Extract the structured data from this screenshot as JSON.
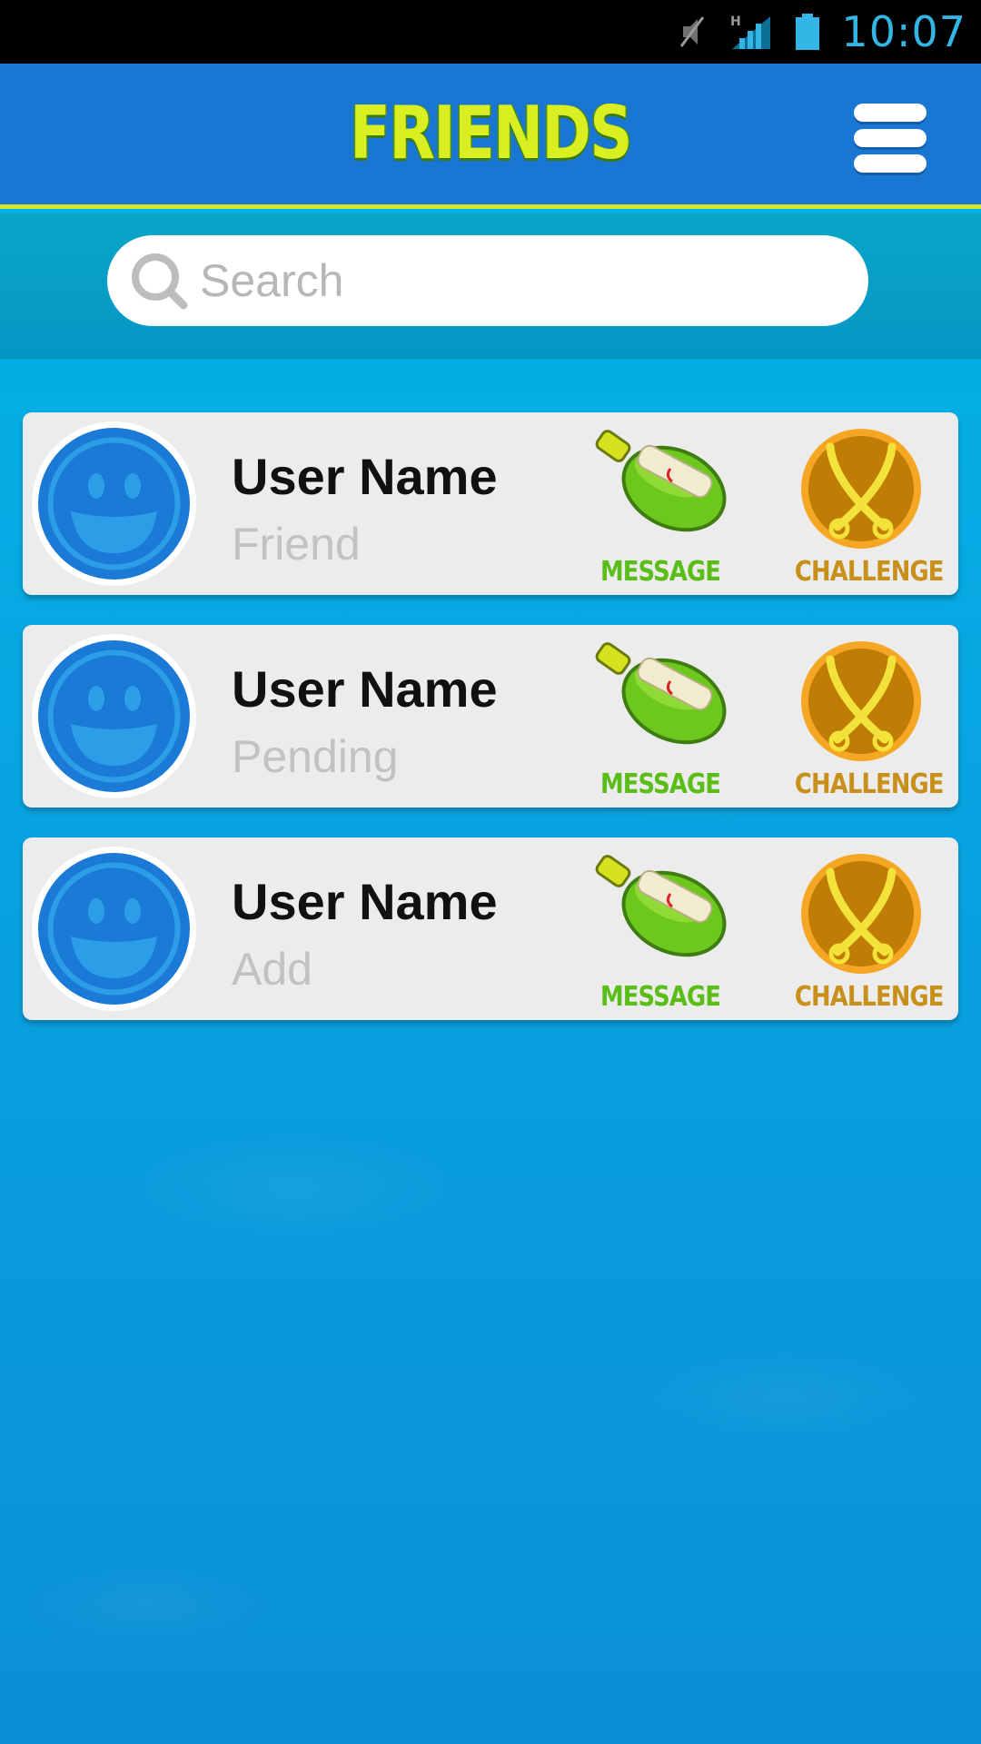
{
  "status_bar": {
    "time": "10:07",
    "icons": [
      "mute-icon",
      "signal-h-icon",
      "battery-icon"
    ],
    "time_color": "#33b5e5"
  },
  "header": {
    "title": "FRIENDS",
    "menu_icon": "hamburger-menu-icon",
    "background": "#1976d2",
    "title_color": "#d9ef22"
  },
  "search": {
    "placeholder": "Search",
    "value": ""
  },
  "friends": [
    {
      "name": "User Name",
      "status": "Friend",
      "message_label": "MESSAGE",
      "challenge_label": "CHALLENGE"
    },
    {
      "name": "User Name",
      "status": "Pending",
      "message_label": "MESSAGE",
      "challenge_label": "CHALLENGE"
    },
    {
      "name": "User Name",
      "status": "Add",
      "message_label": "MESSAGE",
      "challenge_label": "CHALLENGE"
    }
  ],
  "colors": {
    "message": "#5bbd17",
    "challenge": "#c8901a",
    "avatar": "#1b7ad6"
  }
}
